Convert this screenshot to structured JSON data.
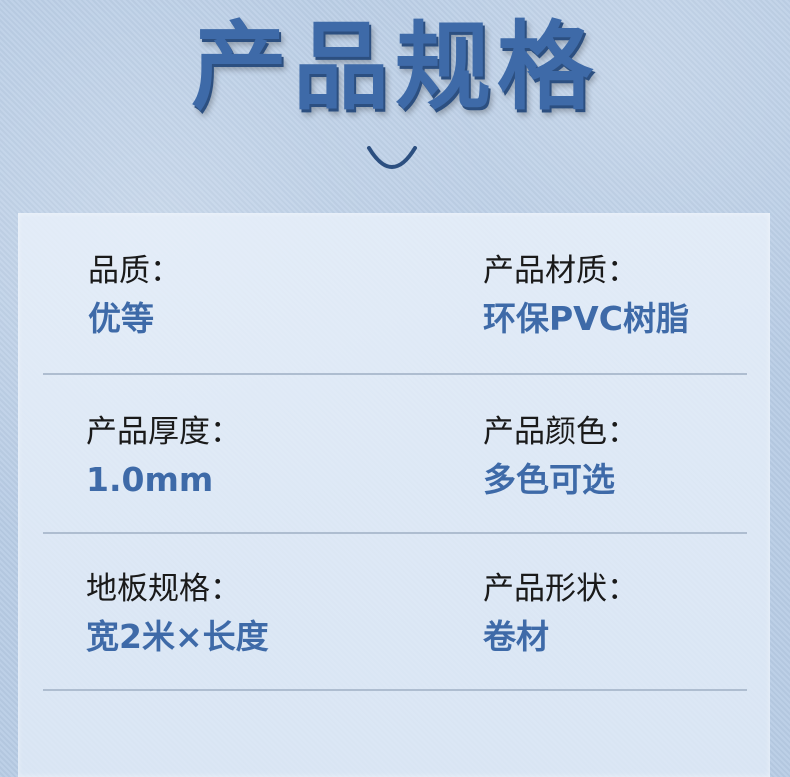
{
  "header": {
    "title": "产品规格"
  },
  "specs": [
    {
      "left": {
        "label": "品质：",
        "value": "优等"
      },
      "right": {
        "label": "产品材质：",
        "value": "环保PVC树脂"
      }
    },
    {
      "left": {
        "label": "产品厚度：",
        "value": "1.0mm"
      },
      "right": {
        "label": "产品颜色：",
        "value": "多色可选"
      }
    },
    {
      "left": {
        "label": "地板规格：",
        "value": "宽2米×长度"
      },
      "right": {
        "label": "产品形状：",
        "value": "卷材"
      }
    }
  ],
  "colors": {
    "accent": "#3e6aa8",
    "label": "#1a1a1a",
    "background": "#b9cde6"
  }
}
